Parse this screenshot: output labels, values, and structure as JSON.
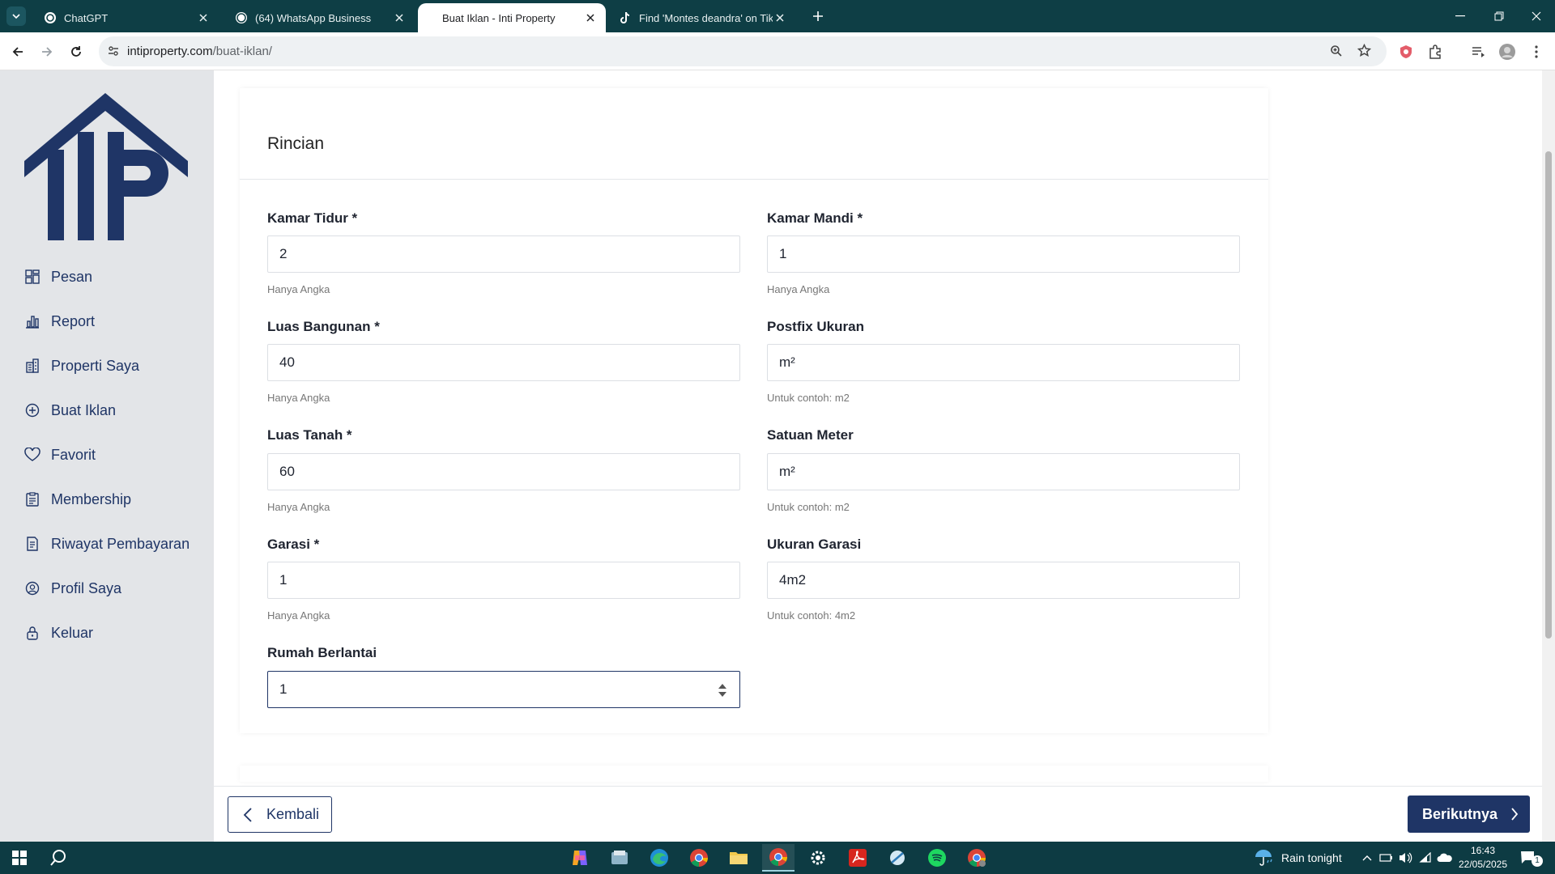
{
  "browser": {
    "tabs": [
      {
        "title": "ChatGPT",
        "icon": "chatgpt-icon"
      },
      {
        "title": "(64) WhatsApp Business",
        "icon": "whatsapp-icon"
      },
      {
        "title": "Buat Iklan - Inti Property",
        "icon": "page-favicon",
        "active": true
      },
      {
        "title": "Find 'Montes deandra' on TikTok",
        "icon": "tiktok-icon"
      }
    ],
    "url_domain": "intiproperty.com",
    "url_path": "/buat-iklan/"
  },
  "sidebar": {
    "logo": "IIP-house-logo",
    "items": [
      {
        "label": "Pesan",
        "icon": "grid-icon"
      },
      {
        "label": "Report",
        "icon": "bar-chart-icon"
      },
      {
        "label": "Properti Saya",
        "icon": "building-icon"
      },
      {
        "label": "Buat Iklan",
        "icon": "plus-circle-icon"
      },
      {
        "label": "Favorit",
        "icon": "heart-icon"
      },
      {
        "label": "Membership",
        "icon": "clipboard-icon"
      },
      {
        "label": "Riwayat Pembayaran",
        "icon": "receipt-icon"
      },
      {
        "label": "Profil Saya",
        "icon": "user-circle-icon"
      },
      {
        "label": "Keluar",
        "icon": "lock-icon"
      }
    ]
  },
  "form": {
    "title": "Rincian",
    "kamar_tidur": {
      "label": "Kamar Tidur *",
      "value": "2",
      "hint": "Hanya Angka"
    },
    "kamar_mandi": {
      "label": "Kamar Mandi *",
      "value": "1",
      "hint": "Hanya Angka"
    },
    "luas_bangunan": {
      "label": "Luas Bangunan *",
      "value": "40",
      "hint": "Hanya Angka"
    },
    "postfix_ukuran": {
      "label": "Postfix Ukuran",
      "value": "m²",
      "hint": "Untuk contoh: m2"
    },
    "luas_tanah": {
      "label": "Luas Tanah *",
      "value": "60",
      "hint": "Hanya Angka"
    },
    "satuan_meter": {
      "label": "Satuan Meter",
      "value": "m²",
      "hint": "Untuk contoh: m2"
    },
    "garasi": {
      "label": "Garasi *",
      "value": "1",
      "hint": "Hanya Angka"
    },
    "ukuran_garasi": {
      "label": "Ukuran Garasi",
      "value": "4m2",
      "hint": "Untuk contoh: 4m2"
    },
    "rumah_berlantai": {
      "label": "Rumah Berlantai",
      "value": "1"
    }
  },
  "footer": {
    "back_label": "Kembali",
    "next_label": "Berikutnya"
  },
  "taskbar": {
    "apps": [
      "copilot-icon",
      "file-manager-icon",
      "edge-icon",
      "chrome-icon",
      "explorer-folder-icon",
      "chrome-active-icon",
      "settings-gear-icon",
      "acrobat-icon",
      "snipping-icon",
      "spotify-icon",
      "chrome-profile-icon"
    ],
    "weather": "Rain tonight",
    "time": "16:43",
    "date": "22/05/2025",
    "notification_count": "1"
  },
  "colors": {
    "brand_navy": "#1f3566",
    "chrome_teal": "#0e3e45",
    "sidebar_bg": "#e3e5e8"
  }
}
